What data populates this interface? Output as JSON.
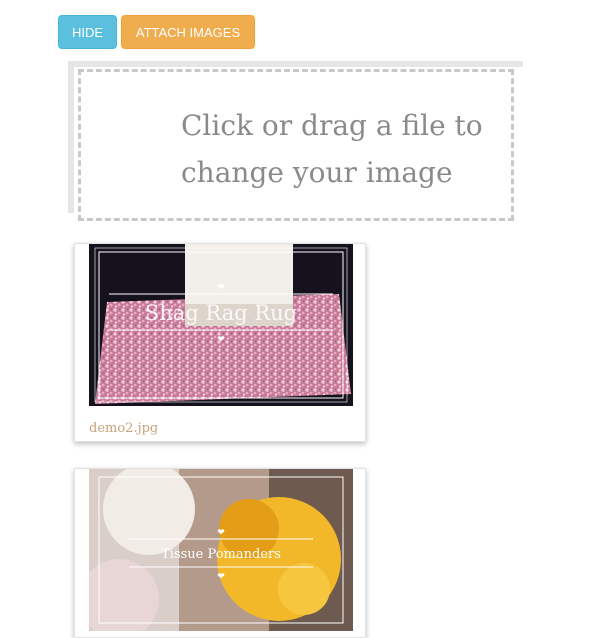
{
  "toolbar": {
    "hide_label": "HIDE",
    "attach_label": "ATTACH IMAGES",
    "hide_color": "#5bc0de",
    "attach_color": "#f0ad4e"
  },
  "dropzone": {
    "line1": "Click or drag a file to",
    "line2": "change your image"
  },
  "images": [
    {
      "filename": "demo2.jpg",
      "overlay_text": "Shag Rag Rug"
    },
    {
      "overlay_text": "Tissue Pomanders"
    }
  ]
}
